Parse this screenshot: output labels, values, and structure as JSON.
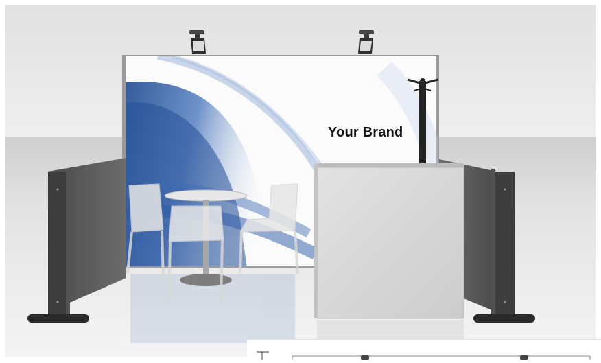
{
  "scene": {
    "brand_text": "Your Brand",
    "colors": {
      "wall": "#e9e9e9",
      "floor": "#dcdcdc",
      "side_panel": "#5c5c5c",
      "counter": "#d7d7d7",
      "graphic_blue": "#2f5fa8"
    }
  },
  "inset": {
    "icons": [
      "spotlight-icon",
      "spotlight-icon"
    ]
  }
}
